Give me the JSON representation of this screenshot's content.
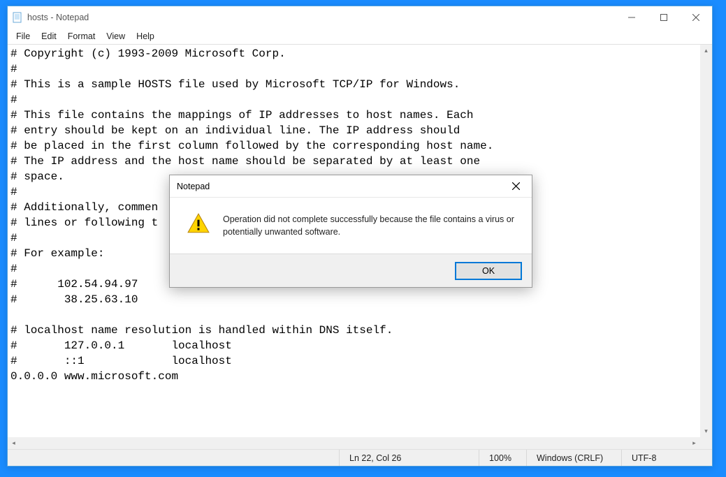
{
  "window": {
    "title": "hosts - Notepad"
  },
  "menu": {
    "file": "File",
    "edit": "Edit",
    "format": "Format",
    "view": "View",
    "help": "Help"
  },
  "editor": {
    "content": "# Copyright (c) 1993-2009 Microsoft Corp.\n#\n# This is a sample HOSTS file used by Microsoft TCP/IP for Windows.\n#\n# This file contains the mappings of IP addresses to host names. Each\n# entry should be kept on an individual line. The IP address should\n# be placed in the first column followed by the corresponding host name.\n# The IP address and the host name should be separated by at least one\n# space.\n#\n# Additionally, commen\n# lines or following t\n#\n# For example:\n#\n#      102.54.94.97\n#       38.25.63.10\n\n# localhost name resolution is handled within DNS itself.\n#       127.0.0.1       localhost\n#       ::1             localhost\n0.0.0.0 www.microsoft.com"
  },
  "statusbar": {
    "position": "Ln 22, Col 26",
    "zoom": "100%",
    "line_ending": "Windows (CRLF)",
    "encoding": "UTF-8"
  },
  "dialog": {
    "title": "Notepad",
    "message": "Operation did not complete successfully because the file contains a virus or potentially unwanted software.",
    "ok": "OK"
  }
}
